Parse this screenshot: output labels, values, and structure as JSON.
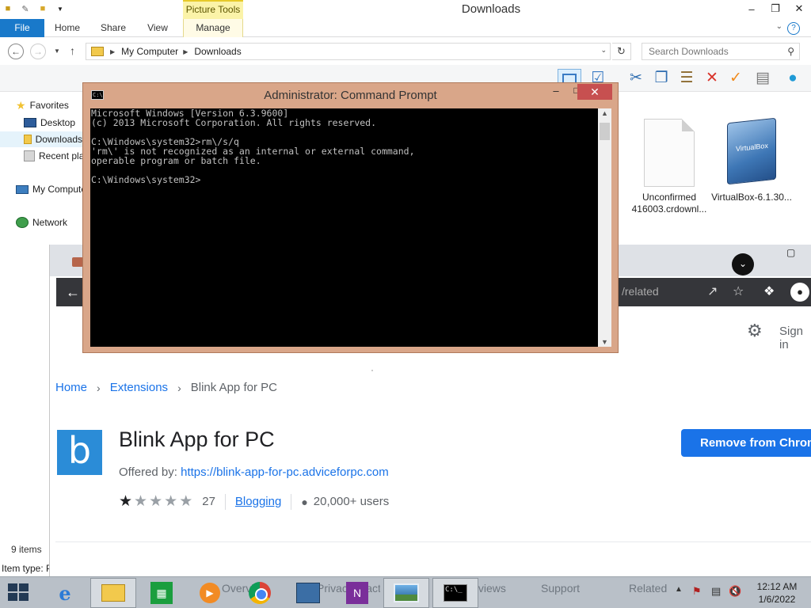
{
  "explorer": {
    "title": "Downloads",
    "context_tab_label": "Picture Tools",
    "tabs": [
      "File",
      "Home",
      "Share",
      "View",
      "Manage"
    ],
    "address": {
      "crumbs": [
        "My Computer",
        "Downloads"
      ]
    },
    "search_placeholder": "Search Downloads",
    "nav": {
      "favorites": "Favorites",
      "desktop": "Desktop",
      "downloads": "Downloads",
      "recent": "Recent places",
      "computer": "My Computer",
      "network": "Network"
    },
    "files": [
      {
        "line1": "Unconfirmed",
        "line2": "416003.crdownl..."
      },
      {
        "line1": "VirtualBox-6.1.30..."
      }
    ],
    "status_items": "9 items",
    "status_type": "Item type: P"
  },
  "cmd": {
    "title": "Administrator: Command Prompt",
    "lines": [
      "Microsoft Windows [Version 6.3.9600]",
      "(c) 2013 Microsoft Corporation. All rights reserved.",
      "",
      "C:\\Windows\\system32>rm\\/s/q",
      "'rm\\' is not recognized as an internal or external command,",
      "operable program or batch file.",
      "",
      "C:\\Windows\\system32>"
    ]
  },
  "chrome": {
    "url_fragment": "/related",
    "signin": "Sign in",
    "breadcrumb": [
      "Home",
      "Extensions",
      "Blink App for PC"
    ],
    "extension": {
      "logo_letter": "b",
      "name": "Blink App for PC",
      "offered_by_label": "Offered by:",
      "offered_by_url": "https://blink-app-for-pc.adviceforpc.com",
      "rating": 1,
      "rating_count": "27",
      "category": "Blogging",
      "users": "20,000+ users",
      "remove_button": "Remove from Chrome"
    }
  },
  "taskbar": {
    "background_tabs": [
      "Overview",
      "Privacy practices",
      "Reviews",
      "Support",
      "Related"
    ],
    "clock_time": "12:12 AM",
    "clock_date": "1/6/2022"
  },
  "colors": {
    "file_tab": "#1979ca",
    "context_tab": "#fbf3a8",
    "cmd_frame": "#d9a689",
    "cmd_close": "#c75050",
    "chrome_link": "#1a73e8",
    "taskbar": "#b9c0c8"
  }
}
